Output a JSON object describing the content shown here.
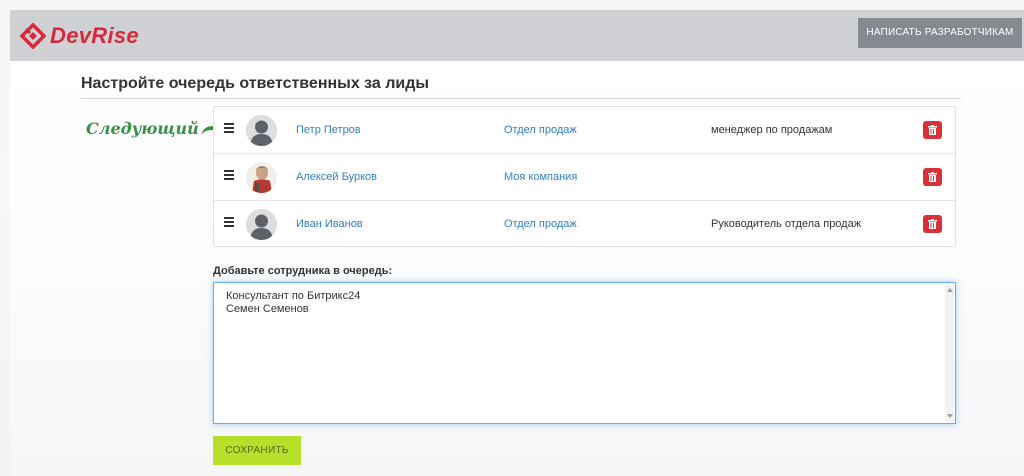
{
  "header": {
    "logo_text": "DevRise",
    "dev_button": "НАПИСАТЬ РАЗРАБОТЧИКАМ"
  },
  "page": {
    "title": "Настройте очередь ответственных за лиды",
    "next_label": "Следующий"
  },
  "queue": [
    {
      "name": "Петр Петров",
      "department": "Отдел продаж",
      "role": "менеджер по продажам",
      "avatar": "default-avatar"
    },
    {
      "name": "Алексей Бурков",
      "department": "Моя компания",
      "role": "",
      "avatar": "photo-avatar"
    },
    {
      "name": "Иван Иванов",
      "department": "Отдел продаж",
      "role": "Руководитель отдела продаж",
      "avatar": "default-avatar"
    }
  ],
  "add": {
    "label": "Добавьте сотрудника в очередь:",
    "lines": [
      "Консультант по Битрикс24",
      "Семен Семенов"
    ]
  },
  "save_button": "СОХРАНИТЬ",
  "colors": {
    "brand_red": "#d9283a",
    "link_blue": "#2f7fc1",
    "delete_red": "#d93138",
    "save_green": "#b8e02a",
    "next_green": "#3a8f4a"
  }
}
